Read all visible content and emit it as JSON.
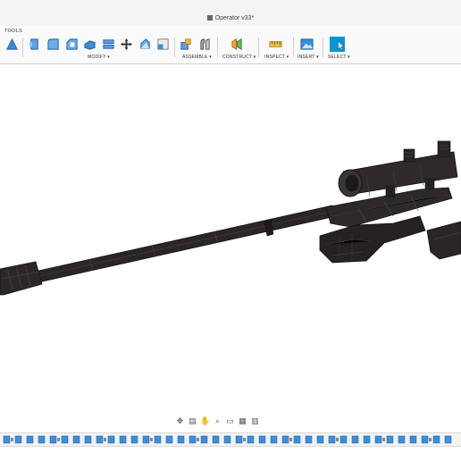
{
  "window": {
    "title": "Operator v33*"
  },
  "toolbar": {
    "tab": "TOOLS",
    "groups": {
      "modify": "MODIFY ▾",
      "assemble": "ASSEMBLE ▾",
      "construct": "CONSTRUCT ▾",
      "inspect": "INSPECT ▾",
      "insert": "INSERT ▾",
      "select": "SELECT ▾"
    }
  },
  "colors": {
    "accent": "#0696d7",
    "icon_blue": "#3b8fd9",
    "model_dark": "#2a2626",
    "model_edge": "#1a1717"
  },
  "icons": {
    "navbar": [
      "orbit-icon",
      "pan-icon",
      "hand-icon",
      "zoom-icon",
      "display-settings-icon",
      "grid-icon",
      "viewports-icon"
    ],
    "timeline": "timeline-feature-icons"
  }
}
